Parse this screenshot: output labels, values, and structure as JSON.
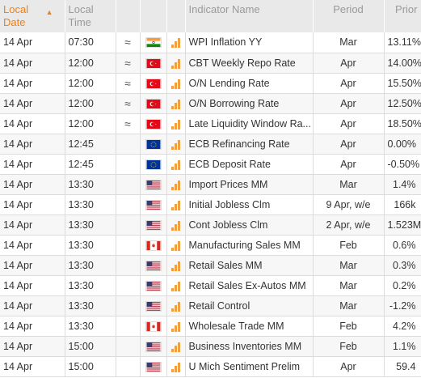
{
  "headers": {
    "local_date": "Local Date",
    "local_time": "Local Time",
    "indicator": "Indicator Name",
    "period": "Period",
    "prior": "Prior"
  },
  "rows": [
    {
      "date": "14 Apr",
      "time": "07:30",
      "approx": "≈",
      "country": "IN",
      "indicator": "WPI Inflation YY",
      "period": "Mar",
      "prior": "13.11%",
      "impact": "high"
    },
    {
      "date": "14 Apr",
      "time": "12:00",
      "approx": "≈",
      "country": "TR",
      "indicator": "CBT Weekly Repo Rate",
      "period": "Apr",
      "prior": "14.00%",
      "impact": "high"
    },
    {
      "date": "14 Apr",
      "time": "12:00",
      "approx": "≈",
      "country": "TR",
      "indicator": "O/N Lending Rate",
      "period": "Apr",
      "prior": "15.50%",
      "impact": "high"
    },
    {
      "date": "14 Apr",
      "time": "12:00",
      "approx": "≈",
      "country": "TR",
      "indicator": "O/N Borrowing Rate",
      "period": "Apr",
      "prior": "12.50%",
      "impact": "high"
    },
    {
      "date": "14 Apr",
      "time": "12:00",
      "approx": "≈",
      "country": "TR",
      "indicator": "Late Liquidity Window Ra...",
      "period": "Apr",
      "prior": "18.50%",
      "impact": "high"
    },
    {
      "date": "14 Apr",
      "time": "12:45",
      "approx": "",
      "country": "EU",
      "indicator": "ECB Refinancing Rate",
      "period": "Apr",
      "prior": "0.00%",
      "impact": "high"
    },
    {
      "date": "14 Apr",
      "time": "12:45",
      "approx": "",
      "country": "EU",
      "indicator": "ECB Deposit Rate",
      "period": "Apr",
      "prior": "-0.50%",
      "impact": "high"
    },
    {
      "date": "14 Apr",
      "time": "13:30",
      "approx": "",
      "country": "US",
      "indicator": "Import Prices MM",
      "period": "Mar",
      "prior": "1.4%",
      "impact": "high"
    },
    {
      "date": "14 Apr",
      "time": "13:30",
      "approx": "",
      "country": "US",
      "indicator": "Initial Jobless Clm",
      "period": "9 Apr, w/e",
      "prior": "166k",
      "impact": "high"
    },
    {
      "date": "14 Apr",
      "time": "13:30",
      "approx": "",
      "country": "US",
      "indicator": "Cont Jobless Clm",
      "period": "2 Apr, w/e",
      "prior": "1.523M",
      "impact": "high"
    },
    {
      "date": "14 Apr",
      "time": "13:30",
      "approx": "",
      "country": "CA",
      "indicator": "Manufacturing Sales MM",
      "period": "Feb",
      "prior": "0.6%",
      "impact": "high"
    },
    {
      "date": "14 Apr",
      "time": "13:30",
      "approx": "",
      "country": "US",
      "indicator": "Retail Sales MM",
      "period": "Mar",
      "prior": "0.3%",
      "impact": "high"
    },
    {
      "date": "14 Apr",
      "time": "13:30",
      "approx": "",
      "country": "US",
      "indicator": "Retail Sales Ex-Autos MM",
      "period": "Mar",
      "prior": "0.2%",
      "impact": "high"
    },
    {
      "date": "14 Apr",
      "time": "13:30",
      "approx": "",
      "country": "US",
      "indicator": "Retail Control",
      "period": "Mar",
      "prior": "-1.2%",
      "impact": "high"
    },
    {
      "date": "14 Apr",
      "time": "13:30",
      "approx": "",
      "country": "CA",
      "indicator": "Wholesale Trade MM",
      "period": "Feb",
      "prior": "4.2%",
      "impact": "high"
    },
    {
      "date": "14 Apr",
      "time": "15:00",
      "approx": "",
      "country": "US",
      "indicator": "Business Inventories MM",
      "period": "Feb",
      "prior": "1.1%",
      "impact": "high"
    },
    {
      "date": "14 Apr",
      "time": "15:00",
      "approx": "",
      "country": "US",
      "indicator": "U Mich Sentiment Prelim",
      "period": "Apr",
      "prior": "59.4",
      "impact": "high"
    }
  ]
}
